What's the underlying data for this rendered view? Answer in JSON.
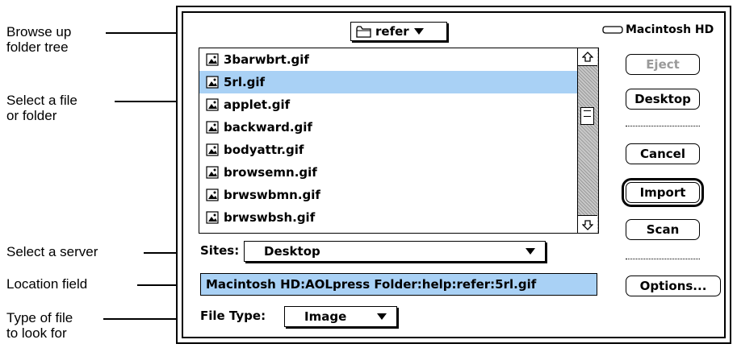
{
  "callouts": [
    {
      "text": "Browse up folder tree"
    },
    {
      "text": "Select a file or folder"
    },
    {
      "text": "Select a server"
    },
    {
      "text": "Location field"
    },
    {
      "text": "Type of file to look for"
    }
  ],
  "callout_lines": {
    "browse_1": "Browse up",
    "browse_2": "folder tree",
    "select_1": "Select a file",
    "select_2": "or folder",
    "server": "Select a server",
    "location": "Location field",
    "type_1": "Type of file",
    "type_2": "to look for"
  },
  "folder_popup": {
    "label": "refer",
    "icon": "folder-icon"
  },
  "volume": {
    "label": "Macintosh HD",
    "icon": "hard-drive-icon"
  },
  "files": [
    {
      "name": "3barwbrt.gif",
      "selected": false,
      "icon": "image-file-icon"
    },
    {
      "name": "5rl.gif",
      "selected": true,
      "icon": "image-file-icon"
    },
    {
      "name": "applet.gif",
      "selected": false,
      "icon": "image-file-icon"
    },
    {
      "name": "backward.gif",
      "selected": false,
      "icon": "image-file-icon"
    },
    {
      "name": "bodyattr.gif",
      "selected": false,
      "icon": "image-file-icon"
    },
    {
      "name": "browsemn.gif",
      "selected": false,
      "icon": "image-file-icon"
    },
    {
      "name": "brwswbmn.gif",
      "selected": false,
      "icon": "image-file-icon"
    },
    {
      "name": "brwswbsh.gif",
      "selected": false,
      "icon": "image-file-icon"
    }
  ],
  "buttons": {
    "eject": "Eject",
    "desktop": "Desktop",
    "cancel": "Cancel",
    "import": "Import",
    "scan": "Scan",
    "options": "Options..."
  },
  "sites": {
    "label": "Sites:",
    "value": "Desktop"
  },
  "location": {
    "value": "Macintosh HD:AOLpress Folder:help:refer:5rl.gif"
  },
  "file_type": {
    "label": "File Type:",
    "value": "Image"
  },
  "colors": {
    "selection": "#a9d1f5",
    "disabled_text": "#9a9a9a"
  }
}
